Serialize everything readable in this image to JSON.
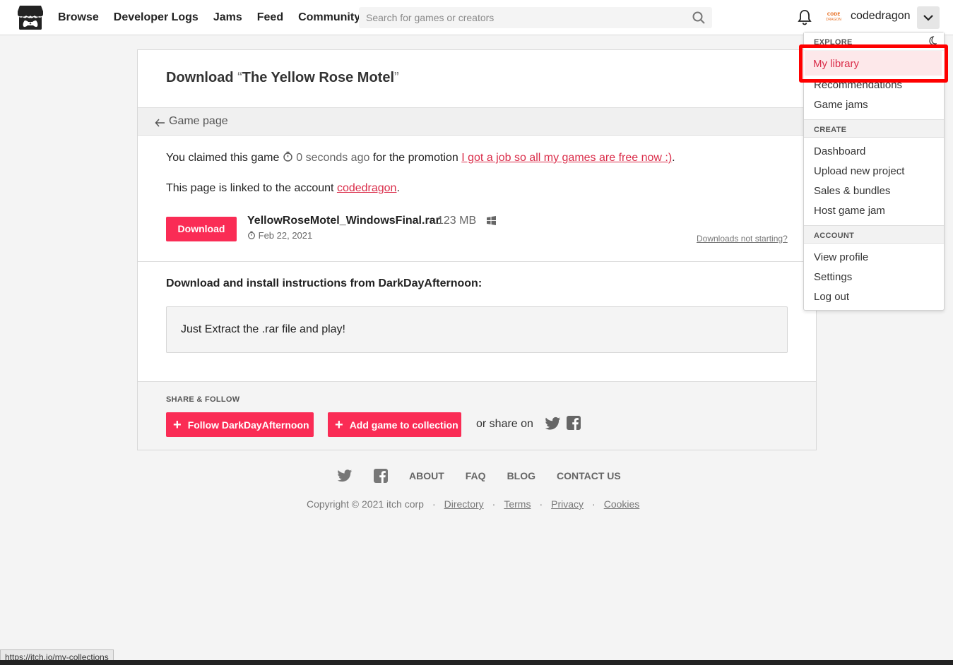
{
  "header": {
    "nav": [
      "Browse",
      "Developer Logs",
      "Jams",
      "Feed",
      "Community"
    ],
    "search_placeholder": "Search for games or creators",
    "username": "codedragon",
    "avatar_text": "CODE DRAGON"
  },
  "page": {
    "title_prefix": "Download ",
    "quote_open": "“",
    "game_title": "The Yellow Rose Motel",
    "quote_close": "”",
    "breadcrumb": "Game page",
    "claimed_prefix": "You claimed this game",
    "claimed_time": "0 seconds ago",
    "claimed_mid": "for the promotion",
    "promotion_link": "I got a job so all my games are free now :)",
    "claimed_end": ".",
    "linked_prefix": "This page is linked to the account",
    "linked_account": "codedragon",
    "linked_end": ".",
    "download_button": "Download",
    "file_name": "YellowRoseMotel_WindowsFinal.rar",
    "file_size": "123 MB",
    "file_date": "Feb 22, 2021",
    "downloads_not_starting": "Downloads not starting?",
    "instructions_heading": "Download and install instructions from DarkDayAfternoon:",
    "instructions_text": "Just Extract the .rar file and play!",
    "share_heading": "SHARE & FOLLOW",
    "follow_button": "Follow DarkDayAfternoon",
    "collection_button": "Add game to collection",
    "share_on": "or share on"
  },
  "footer": {
    "links": [
      "ABOUT",
      "FAQ",
      "BLOG",
      "CONTACT US"
    ],
    "copyright": "Copyright © 2021 itch corp",
    "legal": [
      "Directory",
      "Terms",
      "Privacy",
      "Cookies"
    ],
    "separator": "·"
  },
  "menu": {
    "explore_label": "EXPLORE",
    "explore_items": [
      "My library",
      "Recommendations",
      "Game jams"
    ],
    "create_label": "CREATE",
    "create_items": [
      "Dashboard",
      "Upload new project",
      "Sales & bundles",
      "Host game jam"
    ],
    "account_label": "ACCOUNT",
    "account_items": [
      "View profile",
      "Settings",
      "Log out"
    ]
  },
  "status_url": "https://itch.io/my-collections",
  "colors": {
    "accent": "#fa2c55",
    "link": "#da2c49",
    "highlight_border": "#ff0000"
  },
  "icons": [
    "itch-logo-icon",
    "search-icon",
    "bell-icon",
    "chevron-down-icon",
    "arrow-left-icon",
    "clock-icon",
    "windows-icon",
    "plus-icon",
    "twitter-icon",
    "facebook-icon",
    "moon-icon"
  ]
}
